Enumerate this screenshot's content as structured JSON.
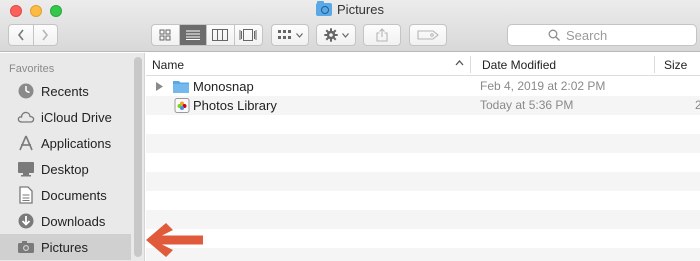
{
  "window": {
    "title": "Pictures",
    "colors": {
      "close": "#fc605c",
      "minimize": "#fdbc40",
      "maximize": "#34c84a",
      "folder": "#5aa9e6",
      "annotation_arrow": "#e05b3c"
    }
  },
  "toolbar": {
    "back_icon": "chevron-left-icon",
    "forward_icon": "chevron-right-icon",
    "views": [
      "icon-view-icon",
      "list-view-icon",
      "column-view-icon",
      "gallery-view-icon"
    ],
    "active_view": "list-view-icon",
    "group_icon": "group-grid-icon",
    "action_icon": "gear-icon",
    "share_icon": "share-icon",
    "tag_icon": "tag-icon",
    "search_placeholder": "Search"
  },
  "sidebar": {
    "heading": "Favorites",
    "items": [
      {
        "label": "Recents",
        "icon": "clock-icon"
      },
      {
        "label": "iCloud Drive",
        "icon": "cloud-icon"
      },
      {
        "label": "Applications",
        "icon": "applications-icon"
      },
      {
        "label": "Desktop",
        "icon": "desktop-icon"
      },
      {
        "label": "Documents",
        "icon": "document-icon"
      },
      {
        "label": "Downloads",
        "icon": "download-icon"
      },
      {
        "label": "Pictures",
        "icon": "camera-icon",
        "selected": true
      }
    ]
  },
  "list": {
    "columns": {
      "name": "Name",
      "date": "Date Modified",
      "size": "Size"
    },
    "rows": [
      {
        "name": "Monosnap",
        "date": "Feb 4, 2019 at 2:02 PM",
        "size": "",
        "type": "folder"
      },
      {
        "name": "Photos Library",
        "date": "Today at 5:36 PM",
        "size": "2",
        "type": "photos-library"
      }
    ]
  }
}
